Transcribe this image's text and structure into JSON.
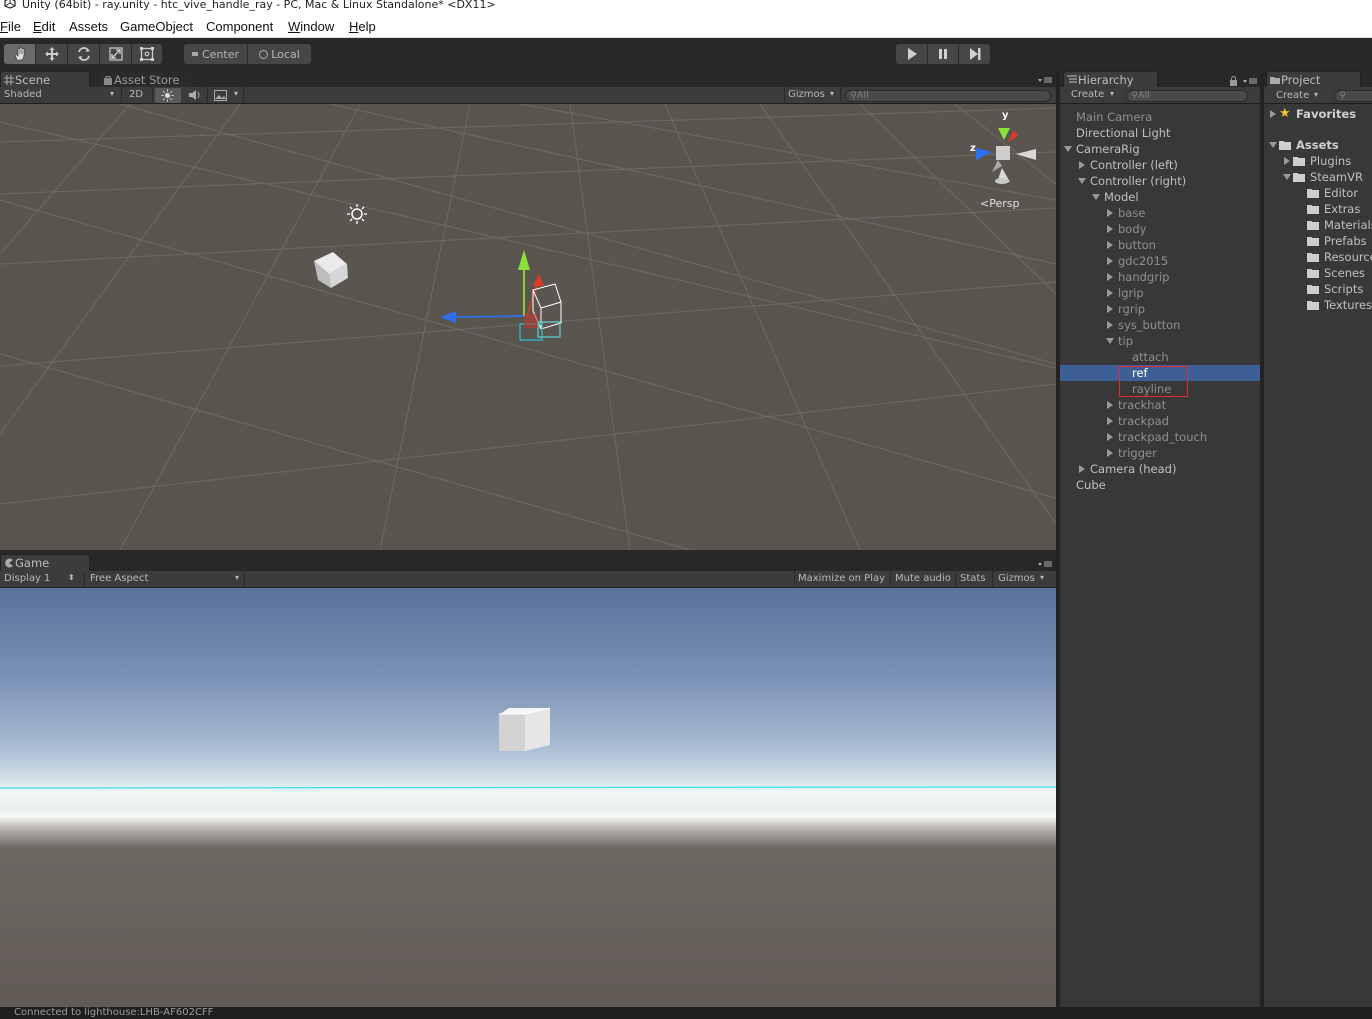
{
  "window": {
    "title": "Unity (64bit) - ray.unity - htc_vive_handle_ray - PC, Mac & Linux Standalone* <DX11>"
  },
  "menu": [
    {
      "label": "File",
      "u": "F",
      "rest": "ile"
    },
    {
      "label": "Edit",
      "u": "E",
      "rest": "dit"
    },
    {
      "label": "Assets",
      "u": "",
      "rest": "Assets"
    },
    {
      "label": "GameObject",
      "u": "",
      "rest": "GameObject"
    },
    {
      "label": "Component",
      "u": "",
      "rest": "Component"
    },
    {
      "label": "Window",
      "u": "W",
      "rest": "indow"
    },
    {
      "label": "Help",
      "u": "H",
      "rest": "elp"
    }
  ],
  "toolbar": {
    "tools": [
      "hand-icon",
      "move-icon",
      "rotate-icon",
      "scale-icon",
      "rect-tool-icon"
    ],
    "active_tool": "hand-icon",
    "pivot": "Center",
    "space": "Local",
    "play_icons": [
      "play-icon",
      "pause-icon",
      "step-icon"
    ]
  },
  "scene_panel": {
    "tabs": [
      "Scene",
      "Asset Store"
    ],
    "shading": "Shaded",
    "mode_2d": "2D",
    "gizmos": "Gizmos",
    "search": "All",
    "persp": "Persp",
    "axis_y": "y",
    "axis_z": "z"
  },
  "game_panel": {
    "tab": "Game",
    "display": "Display 1",
    "aspect": "Free Aspect",
    "toggles": [
      "Maximize on Play",
      "Mute audio",
      "Stats",
      "Gizmos"
    ]
  },
  "hierarchy": {
    "tab": "Hierarchy",
    "create": "Create",
    "search": "All",
    "items": [
      {
        "label": "Main Camera",
        "depth": 0,
        "arrow": "",
        "dim": true
      },
      {
        "label": "Directional Light",
        "depth": 0,
        "arrow": ""
      },
      {
        "label": "CameraRig",
        "depth": 0,
        "arrow": "down"
      },
      {
        "label": "Controller (left)",
        "depth": 1,
        "arrow": "right"
      },
      {
        "label": "Controller (right)",
        "depth": 1,
        "arrow": "down"
      },
      {
        "label": "Model",
        "depth": 2,
        "arrow": "down"
      },
      {
        "label": "base",
        "depth": 3,
        "arrow": "right",
        "dim": true
      },
      {
        "label": "body",
        "depth": 3,
        "arrow": "right",
        "dim": true
      },
      {
        "label": "button",
        "depth": 3,
        "arrow": "right",
        "dim": true
      },
      {
        "label": "gdc2015",
        "depth": 3,
        "arrow": "right",
        "dim": true
      },
      {
        "label": "handgrip",
        "depth": 3,
        "arrow": "right",
        "dim": true
      },
      {
        "label": "lgrip",
        "depth": 3,
        "arrow": "right",
        "dim": true
      },
      {
        "label": "rgrip",
        "depth": 3,
        "arrow": "right",
        "dim": true
      },
      {
        "label": "sys_button",
        "depth": 3,
        "arrow": "right",
        "dim": true
      },
      {
        "label": "tip",
        "depth": 3,
        "arrow": "down",
        "dim": true
      },
      {
        "label": "attach",
        "depth": 4,
        "arrow": "",
        "dim": true
      },
      {
        "label": "ref",
        "depth": 4,
        "arrow": "",
        "selected": true
      },
      {
        "label": "rayline",
        "depth": 4,
        "arrow": "",
        "dim": true
      },
      {
        "label": "trackhat",
        "depth": 3,
        "arrow": "right",
        "dim": true
      },
      {
        "label": "trackpad",
        "depth": 3,
        "arrow": "right",
        "dim": true
      },
      {
        "label": "trackpad_touch",
        "depth": 3,
        "arrow": "right",
        "dim": true
      },
      {
        "label": "trigger",
        "depth": 3,
        "arrow": "right",
        "dim": true
      },
      {
        "label": "Camera (head)",
        "depth": 1,
        "arrow": "right"
      },
      {
        "label": "Cube",
        "depth": 0,
        "arrow": ""
      }
    ]
  },
  "project": {
    "tab": "Project",
    "create": "Create",
    "favorites": "Favorites",
    "assets": "Assets",
    "folders": [
      {
        "label": "Plugins",
        "depth": 1,
        "arrow": "right"
      },
      {
        "label": "SteamVR",
        "depth": 1,
        "arrow": "down"
      },
      {
        "label": "Editor",
        "depth": 2,
        "arrow": ""
      },
      {
        "label": "Extras",
        "depth": 2,
        "arrow": ""
      },
      {
        "label": "Materials",
        "depth": 2,
        "arrow": ""
      },
      {
        "label": "Prefabs",
        "depth": 2,
        "arrow": ""
      },
      {
        "label": "Resources",
        "depth": 2,
        "arrow": ""
      },
      {
        "label": "Scenes",
        "depth": 2,
        "arrow": ""
      },
      {
        "label": "Scripts",
        "depth": 2,
        "arrow": ""
      },
      {
        "label": "Textures",
        "depth": 2,
        "arrow": ""
      }
    ]
  },
  "status": "Connected to lighthouse:LHB-AF602CFF",
  "colors": {
    "selection": "#3e5f96",
    "highlight_box": "#e8292c",
    "accent_cyan": "#3ee0e8"
  }
}
